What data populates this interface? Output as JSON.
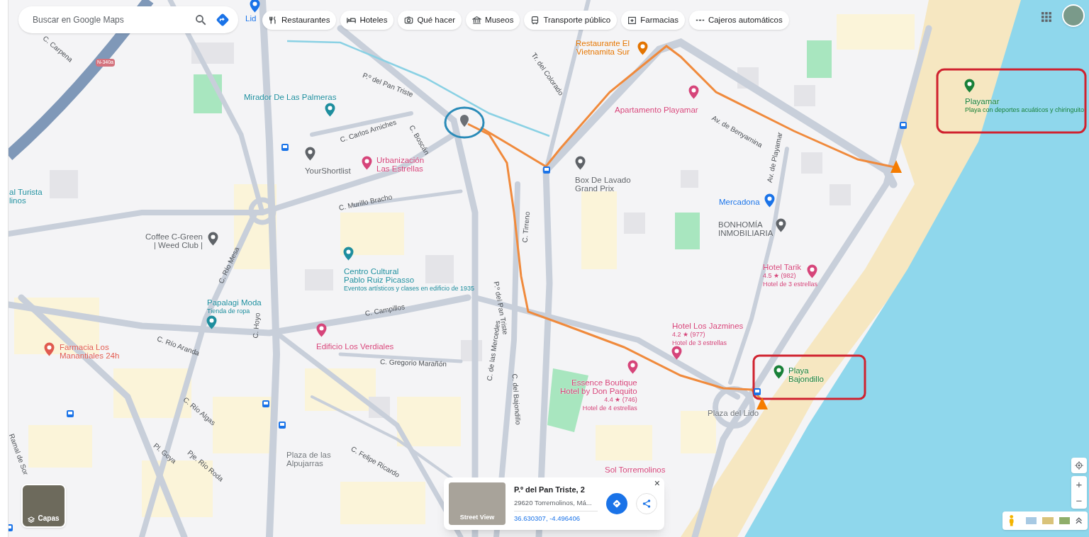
{
  "search": {
    "placeholder": "Buscar en Google Maps"
  },
  "chips": [
    {
      "label": "Restaurantes"
    },
    {
      "label": "Hoteles"
    },
    {
      "label": "Qué hacer"
    },
    {
      "label": "Museos"
    },
    {
      "label": "Transporte público"
    },
    {
      "label": "Farmacias"
    },
    {
      "label": "Cajeros automáticos"
    }
  ],
  "places": [
    {
      "kind": "store",
      "lines": [
        "Lid"
      ]
    },
    {
      "kind": "food",
      "lines": [
        "Restaurante El",
        "Vietnamita Sur"
      ]
    },
    {
      "kind": "attraction",
      "lines": [
        "Mirador De Las Palmeras"
      ]
    },
    {
      "kind": "generic",
      "lines": [
        "YourShortlist"
      ]
    },
    {
      "kind": "hotel",
      "lines": [
        "Urbanización",
        "Las Estrellas"
      ]
    },
    {
      "kind": "hotel",
      "lines": [
        "Apartamento Playamar"
      ]
    },
    {
      "kind": "generic",
      "lines": [
        "Box De Lavado",
        "Grand Prix"
      ]
    },
    {
      "kind": "beach",
      "lines": [
        "Playamar"
      ],
      "sub": [
        "Playa con deportes acuáticos y chiringuito"
      ]
    },
    {
      "kind": "attraction",
      "lines": [
        "al Turista",
        "linos"
      ]
    },
    {
      "kind": "store",
      "lines": [
        "Mercadona"
      ]
    },
    {
      "kind": "generic",
      "lines": [
        "BONHOMÍA",
        "INMOBILIARIA"
      ]
    },
    {
      "kind": "generic",
      "lines": [
        "Coffee C-Green",
        "| Weed Club |"
      ]
    },
    {
      "kind": "attraction",
      "lines": [
        "Centro Cultural",
        "Pablo Ruiz Picasso"
      ],
      "sub": [
        "Eventos artísticos y clases en edificio de 1935"
      ]
    },
    {
      "kind": "hotel",
      "lines": [
        "Hotel Tarik"
      ],
      "sub": [
        "4.5 ★ (982)",
        "Hotel de 3 estrellas"
      ]
    },
    {
      "kind": "shop",
      "lines": [
        "Papalagi Moda"
      ],
      "sub": [
        "Tienda de ropa"
      ]
    },
    {
      "kind": "hotel",
      "lines": [
        "Hotel Los Jazmines"
      ],
      "sub": [
        "4.2 ★ (977)",
        "Hotel de 3 estrellas"
      ]
    },
    {
      "kind": "pharmacy",
      "lines": [
        "Farmacia Los",
        "Manantiales 24h"
      ]
    },
    {
      "kind": "hotel",
      "lines": [
        "Edificio Los Verdiales"
      ]
    },
    {
      "kind": "beach",
      "lines": [
        "Playa",
        "Bajondillo"
      ]
    },
    {
      "kind": "hotel",
      "lines": [
        "Essence Boutique",
        "Hotel by Don Paquito"
      ],
      "sub": [
        "4.4 ★ (746)",
        "Hotel de 4 estrellas"
      ]
    },
    {
      "kind": "area",
      "lines": [
        "Plaza del Lido"
      ]
    },
    {
      "kind": "area",
      "lines": [
        "Plaza de las",
        "Alpujarras"
      ]
    },
    {
      "kind": "hotel",
      "lines": [
        "Sol Torremolinos"
      ]
    }
  ],
  "streets": [
    "C. Carpena",
    "P.º del Pan Triste",
    "Tr. del Colorado",
    "C. Carlos Arniches",
    "C. Boscán",
    "Av. de Benyamina",
    "Av. de Playamar",
    "C. Murillo Bracho",
    "C. Río Mesa",
    "C. Tirreno",
    "P.º del Pan Triste",
    "C. Campillos",
    "C. Río Aranda",
    "C. Hoyo",
    "C. Gregorio Marañón",
    "C. del Bajondillo",
    "C. de las Mercedes",
    "C. Río Algas",
    "Pje. Río Roda",
    "Pl. Goya",
    "C. Felipe Ricardo",
    "Ramal de Sor",
    "N-340a"
  ],
  "card": {
    "photo_label": "Street View",
    "title": "P.º del Pan Triste, 2",
    "address": "29620 Torremolinos, Má...",
    "coords": "36.630307, -4.496406",
    "close": "×"
  },
  "layers": {
    "label": "Capas"
  },
  "zoom": {
    "plus": "+",
    "minus": "−"
  }
}
